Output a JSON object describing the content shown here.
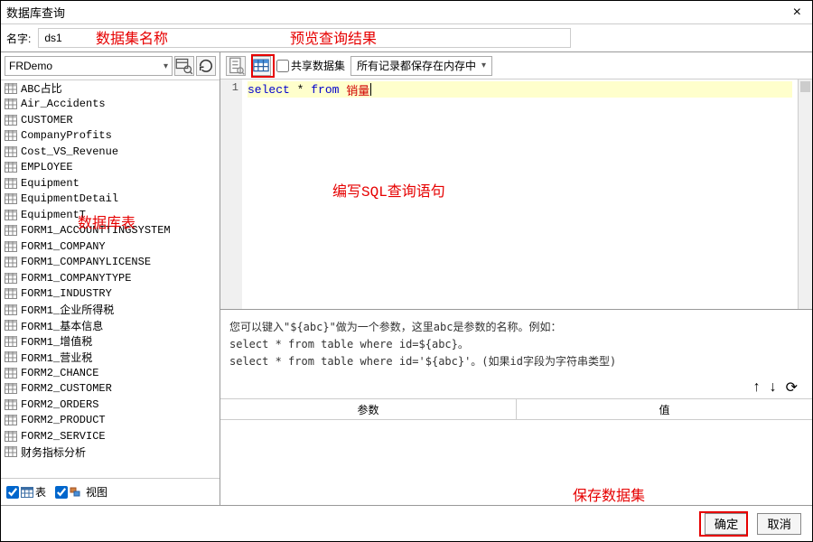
{
  "window": {
    "title": "数据库查询",
    "close": "×"
  },
  "name_row": {
    "label": "名字:",
    "value": "ds1"
  },
  "annotations": {
    "dataset_name": "数据集名称",
    "preview": "预览查询结果",
    "db_tables": "数据库表",
    "write_sql": "编写SQL查询语句",
    "save_ds": "保存数据集"
  },
  "datasource": {
    "selected": "FRDemo"
  },
  "tables": [
    "ABC占比",
    "Air_Accidents",
    "CUSTOMER",
    "CompanyProfits",
    "Cost_VS_Revenue",
    "EMPLOYEE",
    "Equipment",
    "EquipmentDetail",
    "EquipmentT",
    "FORM1_ACCOUNTTINGSYSTEM",
    "FORM1_COMPANY",
    "FORM1_COMPANYLICENSE",
    "FORM1_COMPANYTYPE",
    "FORM1_INDUSTRY",
    "FORM1_企业所得税",
    "FORM1_基本信息",
    "FORM1_增值税",
    "FORM1_营业税",
    "FORM2_CHANCE",
    "FORM2_CUSTOMER",
    "FORM2_ORDERS",
    "FORM2_PRODUCT",
    "FORM2_SERVICE",
    "财务指标分析"
  ],
  "left_footer": {
    "table_label": "表",
    "view_label": "视图"
  },
  "toolbar": {
    "share_label": "共享数据集",
    "memory_label": "所有记录都保存在内存中"
  },
  "sql": {
    "line_no": "1",
    "select": "select",
    "star": "*",
    "from": "from",
    "table": "销量"
  },
  "hint": {
    "line1": "您可以键入\"${abc}\"做为一个参数，这里abc是参数的名称。例如：",
    "line2": "select * from table where id=${abc}。",
    "line3": "select * from table where id='${abc}'。(如果id字段为字符串类型)"
  },
  "param_controls": {
    "up": "↑",
    "down": "↓",
    "refresh": "⟳"
  },
  "param_header": {
    "param": "参数",
    "value": "值"
  },
  "buttons": {
    "ok": "确定",
    "cancel": "取消"
  }
}
